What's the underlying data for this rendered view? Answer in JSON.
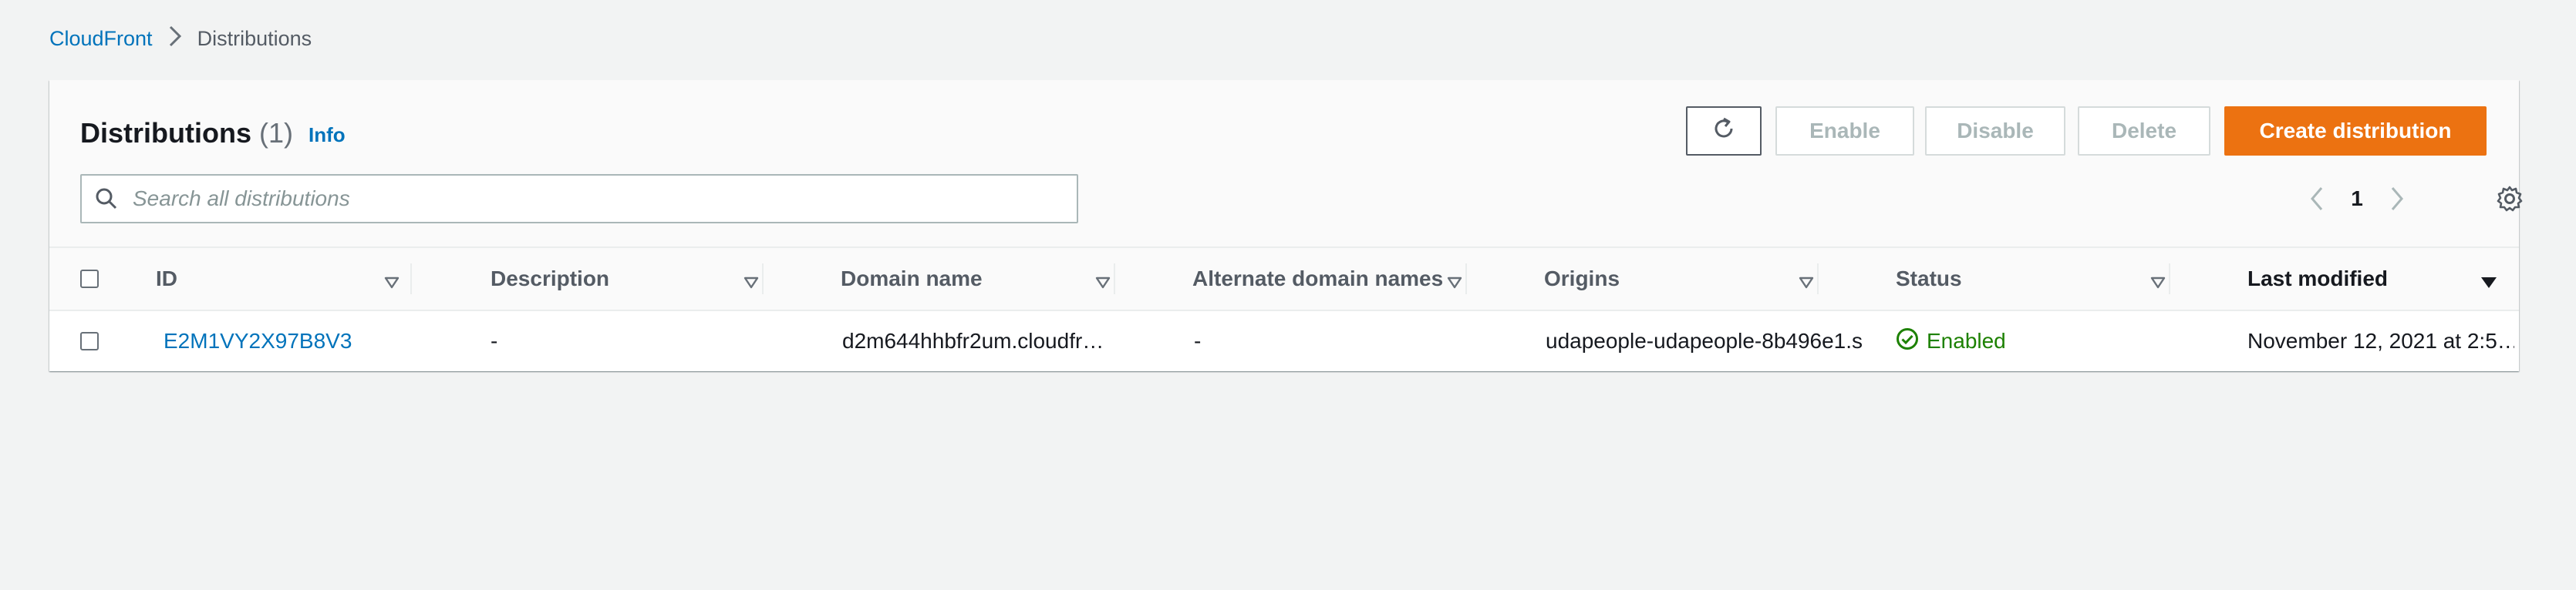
{
  "breadcrumb": {
    "root": "CloudFront",
    "separator": ">",
    "current": "Distributions"
  },
  "panel": {
    "title": "Distributions",
    "count": "(1)",
    "info_label": "Info"
  },
  "toolbar": {
    "refresh_icon": "refresh-icon",
    "enable_label": "Enable",
    "disable_label": "Disable",
    "delete_label": "Delete",
    "create_label": "Create distribution"
  },
  "search": {
    "placeholder": "Search all distributions",
    "value": ""
  },
  "pagination": {
    "current_page": "1"
  },
  "table": {
    "columns": [
      "ID",
      "Description",
      "Domain name",
      "Alternate domain names",
      "Origins",
      "Status",
      "Last modified"
    ],
    "sorted_column": "Last modified",
    "rows": [
      {
        "id": "E2M1VY2X97B8V3",
        "description": "-",
        "domain_name": "d2m644hhbfr2um.cloudfr…",
        "alternate_domain_names": "-",
        "origins": "udapeople-udapeople-8b496e1.s",
        "status": "Enabled",
        "last_modified": "November 12, 2021 at 2:5…"
      }
    ]
  },
  "colors": {
    "link": "#0073bb",
    "primary_button": "#ec7211",
    "status_enabled": "#1d8102",
    "background": "#f2f3f3"
  }
}
